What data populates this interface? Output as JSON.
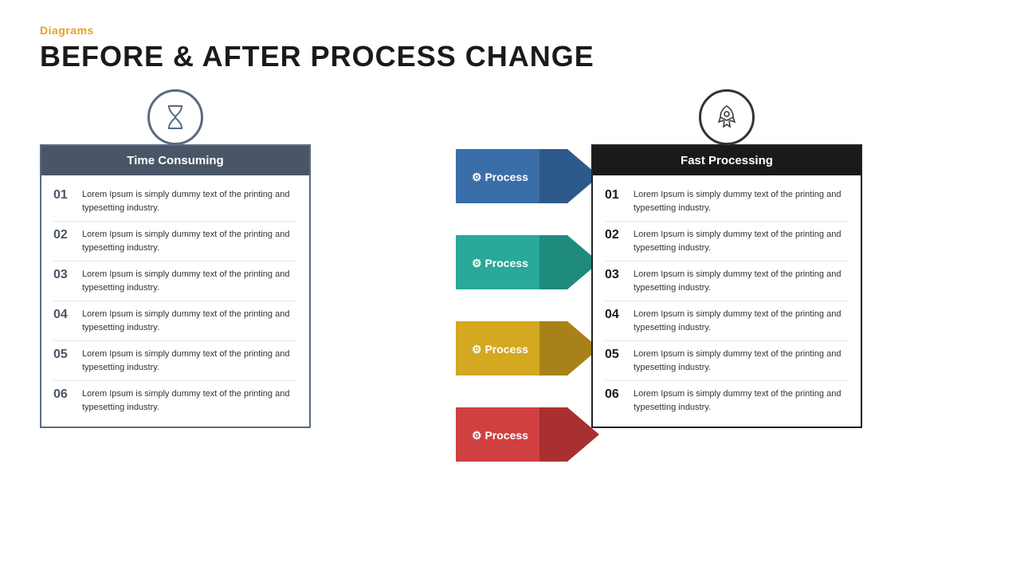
{
  "header": {
    "category": "Diagrams",
    "title": "BEFORE & AFTER PROCESS CHANGE"
  },
  "left": {
    "icon_label": "hourglass-icon",
    "header": "Time Consuming",
    "items": [
      {
        "number": "01",
        "text": "Lorem Ipsum is simply dummy text of the printing and typesetting industry."
      },
      {
        "number": "02",
        "text": "Lorem Ipsum is simply dummy text of the printing and typesetting industry."
      },
      {
        "number": "03",
        "text": "Lorem Ipsum is simply dummy text of the printing and typesetting industry."
      },
      {
        "number": "04",
        "text": "Lorem Ipsum is simply dummy text of the printing and typesetting industry."
      },
      {
        "number": "05",
        "text": "Lorem Ipsum is simply dummy text of the printing and typesetting industry."
      },
      {
        "number": "06",
        "text": "Lorem Ipsum is simply dummy text of the printing and typesetting industry."
      }
    ]
  },
  "processes": [
    {
      "label": "Process",
      "color": "#3a6ea8",
      "dark_color": "#2d5a8a"
    },
    {
      "label": "Process",
      "color": "#2aa89a",
      "dark_color": "#228a7e"
    },
    {
      "label": "Process",
      "color": "#d4a820",
      "dark_color": "#a88218"
    },
    {
      "label": "Process",
      "color": "#d04040",
      "dark_color": "#a83030"
    }
  ],
  "right": {
    "icon_label": "rocket-icon",
    "header": "Fast Processing",
    "items": [
      {
        "number": "01",
        "text": "Lorem Ipsum is simply dummy text of the printing and typesetting industry."
      },
      {
        "number": "02",
        "text": "Lorem Ipsum is simply dummy text of the printing and typesetting industry."
      },
      {
        "number": "03",
        "text": "Lorem Ipsum is simply dummy text of the printing and typesetting industry."
      },
      {
        "number": "04",
        "text": "Lorem Ipsum is simply dummy text of the printing and typesetting industry."
      },
      {
        "number": "05",
        "text": "Lorem Ipsum is simply dummy text of the printing and typesetting industry."
      },
      {
        "number": "06",
        "text": "Lorem Ipsum is simply dummy text of the printing and typesetting industry."
      }
    ]
  },
  "colors": {
    "orange_accent": "#e8a020",
    "dark_slate": "#4a5568",
    "process_blue": "#3a6ea8",
    "process_teal": "#2aa89a",
    "process_gold": "#d4a820",
    "process_red": "#d04040"
  }
}
